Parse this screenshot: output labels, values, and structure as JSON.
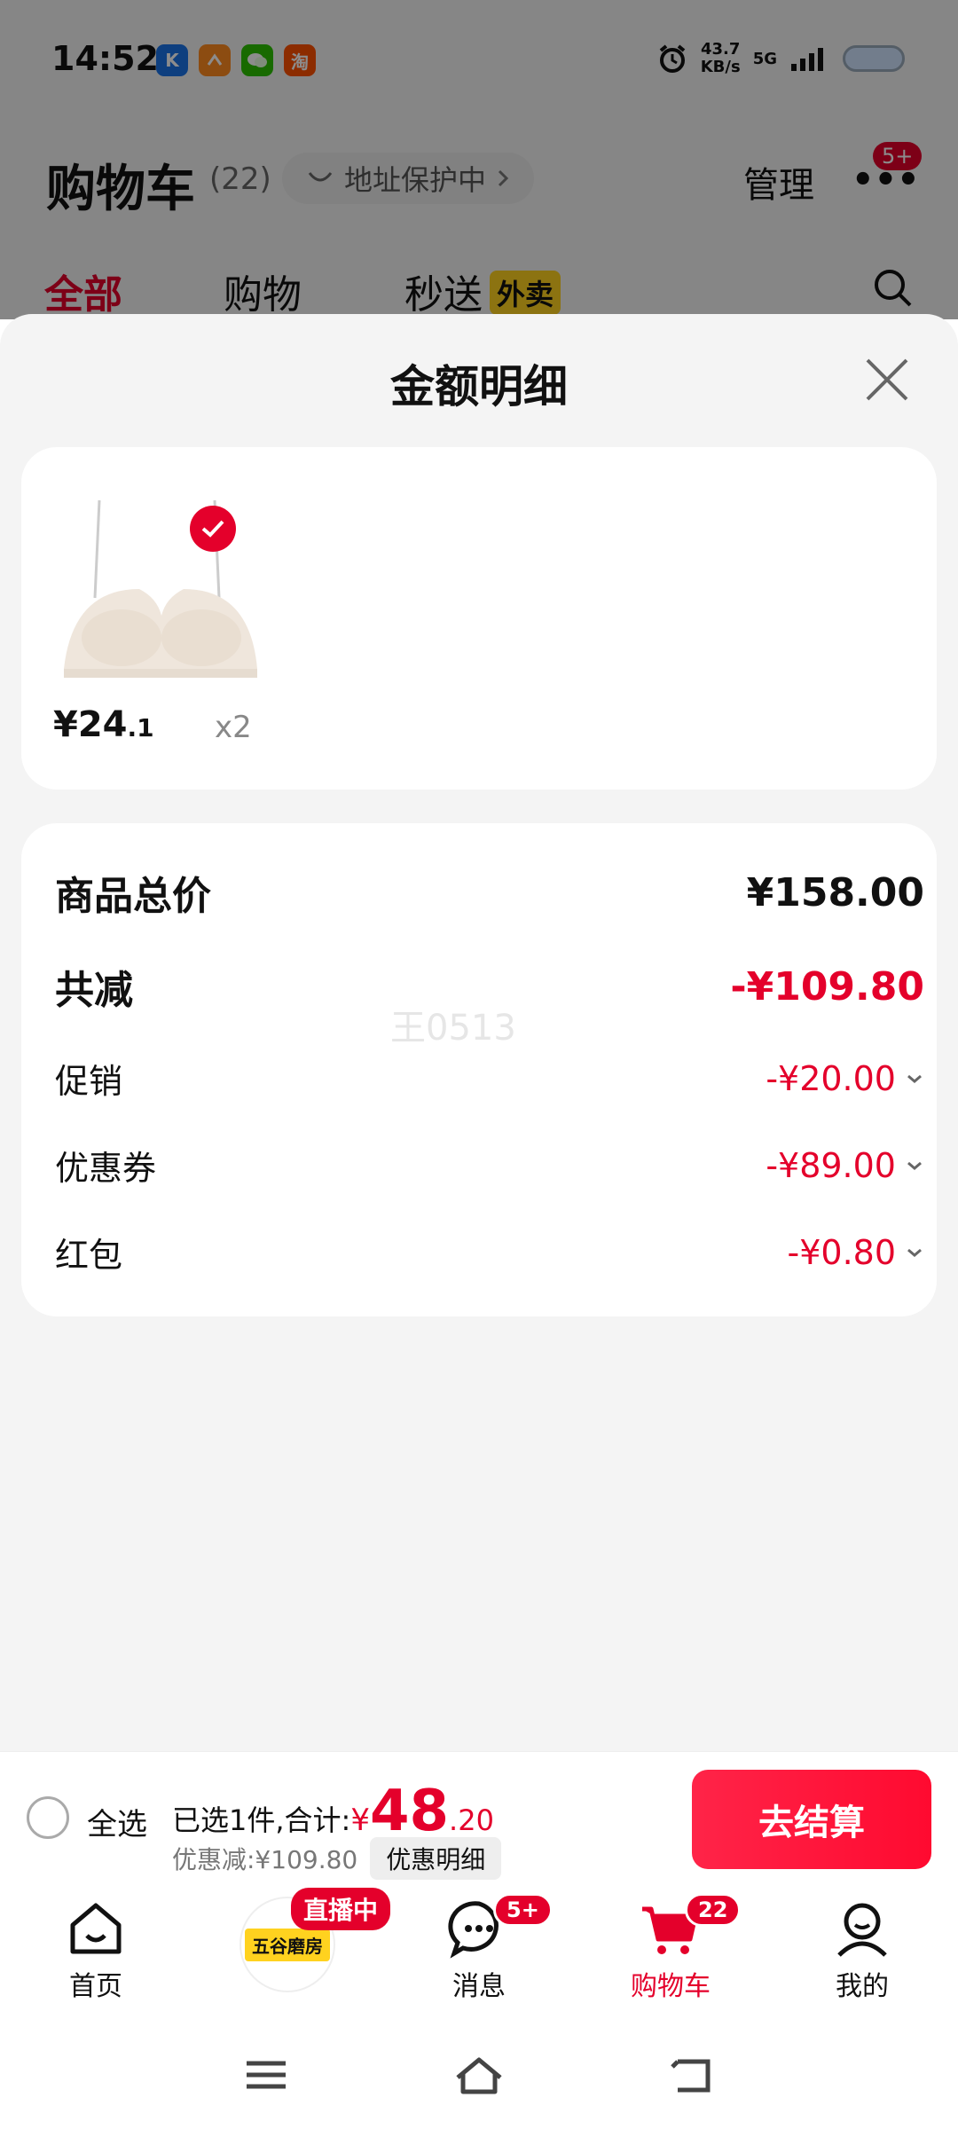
{
  "status_bar": {
    "time": "14:52",
    "apps": [
      {
        "icon": "kuwo-icon",
        "label": "K",
        "color": "#1a73e8"
      },
      {
        "icon": "app-orange-icon",
        "label": "",
        "color": "#ff8a1f"
      },
      {
        "icon": "wechat-icon",
        "label": "",
        "color": "#2dc100"
      },
      {
        "icon": "taobao-icon",
        "label": "淘",
        "color": "#ff5000"
      }
    ],
    "net_speed": "43.7",
    "net_unit": "KB/s",
    "network": "5G"
  },
  "header": {
    "title": "购物车",
    "count": "(22)",
    "address": "地址保护中",
    "manage": "管理",
    "more_badge": "5+"
  },
  "tabs": [
    {
      "label": "全部",
      "active": true
    },
    {
      "label": "购物",
      "active": false
    },
    {
      "label": "秒送",
      "active": false,
      "tag": "外卖"
    }
  ],
  "sheet": {
    "title": "金额明细",
    "product": {
      "price_int": "¥24",
      "price_dec": ".1",
      "qty": "x2"
    },
    "rows": [
      {
        "label": "商品总价",
        "value": "¥158.00"
      },
      {
        "label": "共减",
        "value": "-¥109.80"
      },
      {
        "label": "促销",
        "value": "-¥20.00"
      },
      {
        "label": "优惠券",
        "value": "-¥89.00"
      },
      {
        "label": "红包",
        "value": "-¥0.80"
      }
    ],
    "watermark": "王0513"
  },
  "checkout": {
    "select_all": "全选",
    "selected_text": "已选1件,合计:",
    "total_currency": "¥",
    "total_int": "48",
    "total_dec": ".20",
    "discount_text": "优惠减:¥109.80",
    "discount_detail": "优惠明细",
    "checkout_btn": "去结算"
  },
  "bottom_nav": [
    {
      "label": "首页",
      "icon": "home-icon"
    },
    {
      "label": "",
      "icon": "live-store-icon",
      "badge": "直播中",
      "logo": "五谷磨房"
    },
    {
      "label": "消息",
      "icon": "message-icon",
      "badge": "5+"
    },
    {
      "label": "购物车",
      "icon": "cart-icon",
      "badge": "22",
      "active": true
    },
    {
      "label": "我的",
      "icon": "profile-icon"
    }
  ]
}
